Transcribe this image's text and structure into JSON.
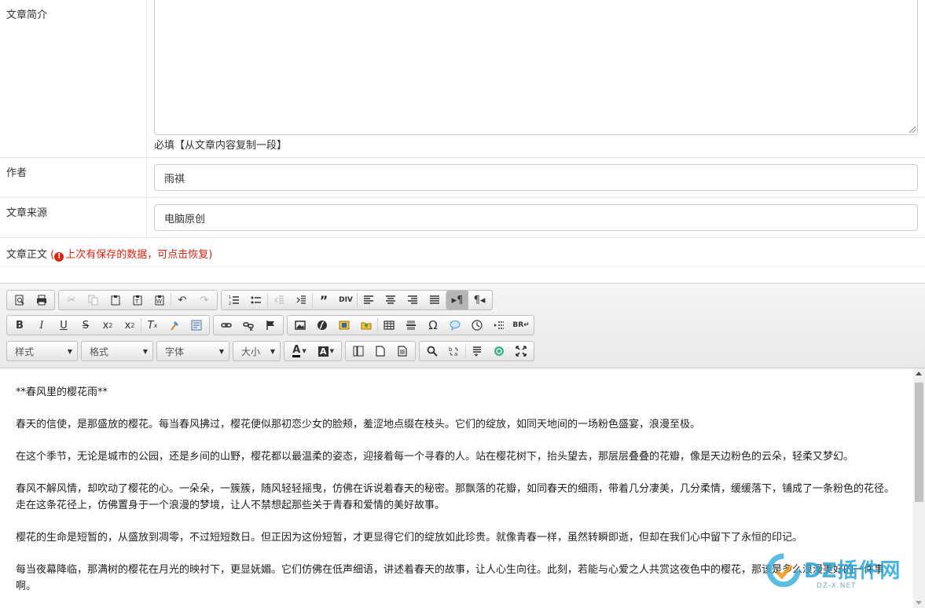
{
  "form": {
    "summary": {
      "label": "文章简介",
      "value": "",
      "hint": "必填【从文章内容复制一段】"
    },
    "author": {
      "label": "作者",
      "value": "雨祺"
    },
    "source": {
      "label": "文章来源",
      "value": "电脑原创"
    },
    "body": {
      "label": "文章正文",
      "notice": "上次有保存的数据，可点击恢复)",
      "notice_prefix": "(",
      "notice_icon": "exclamation-circle-icon"
    }
  },
  "toolbar": {
    "combos": [
      {
        "label": "样式"
      },
      {
        "label": "格式"
      },
      {
        "label": "字体"
      },
      {
        "label": "大小"
      }
    ]
  },
  "content": {
    "paragraphs": [
      "**春风里的樱花雨**",
      "春天的信使，是那盛放的樱花。每当春风拂过，樱花便似那初恋少女的脸颊，羞涩地点缀在枝头。它们的绽放，如同天地间的一场粉色盛宴，浪漫至极。",
      "在这个季节，无论是城市的公园，还是乡间的山野，樱花都以最温柔的姿态，迎接着每一个寻春的人。站在樱花树下，抬头望去，那层层叠叠的花瓣，像是天边粉色的云朵，轻柔又梦幻。",
      "春风不解风情，却吹动了樱花的心。一朵朵，一簇簇，随风轻轻摇曳，仿佛在诉说着春天的秘密。那飘落的花瓣，如同春天的细雨，带着几分凄美，几分柔情，缓缓落下，铺成了一条粉色的花径。走在这条花径上，仿佛置身于一个浪漫的梦境，让人不禁想起那些关于青春和爱情的美好故事。",
      "樱花的生命是短暂的，从盛放到凋零，不过短短数日。但正因为这份短暂，才更显得它们的绽放如此珍贵。就像青春一样，虽然转瞬即逝，但却在我们心中留下了永恒的印记。",
      "每当夜幕降临，那满树的樱花在月光的映衬下，更显妩媚。它们仿佛在低声细语，讲述着春天的故事，让人心生向往。此刻，若能与心爱之人共赏这夜色中的樱花，那该是多么浪漫美好的一件事啊。"
    ]
  },
  "watermark": {
    "text": "DZ插件网",
    "sub": "DZ-X.NET"
  }
}
